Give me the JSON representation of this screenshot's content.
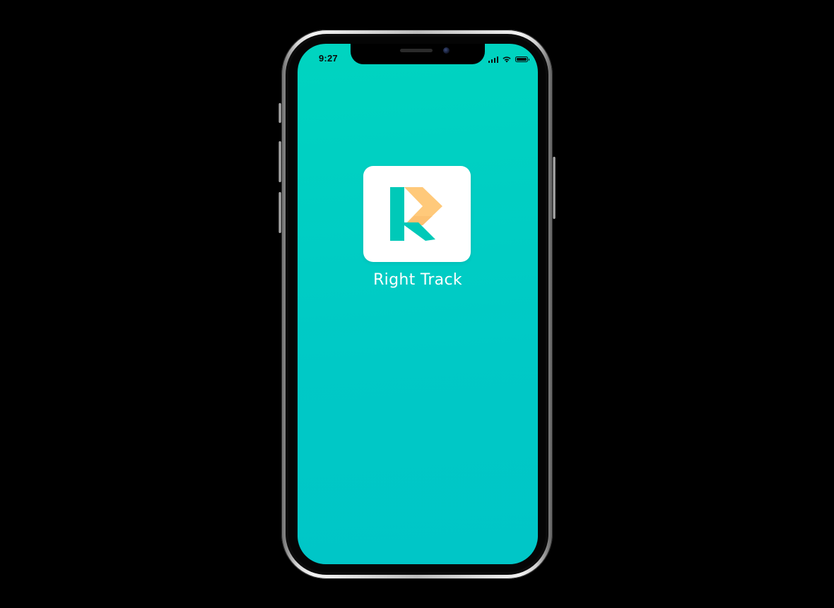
{
  "status_bar": {
    "time": "9:27",
    "icons": [
      "cellular-signal-icon",
      "wifi-icon",
      "battery-icon"
    ]
  },
  "app": {
    "name": "Right Track",
    "logo": "right-track-logo",
    "background_color": "#00CCC4",
    "logo_colors": {
      "teal": "#00C9B8",
      "orange": "#FFC97A"
    }
  }
}
